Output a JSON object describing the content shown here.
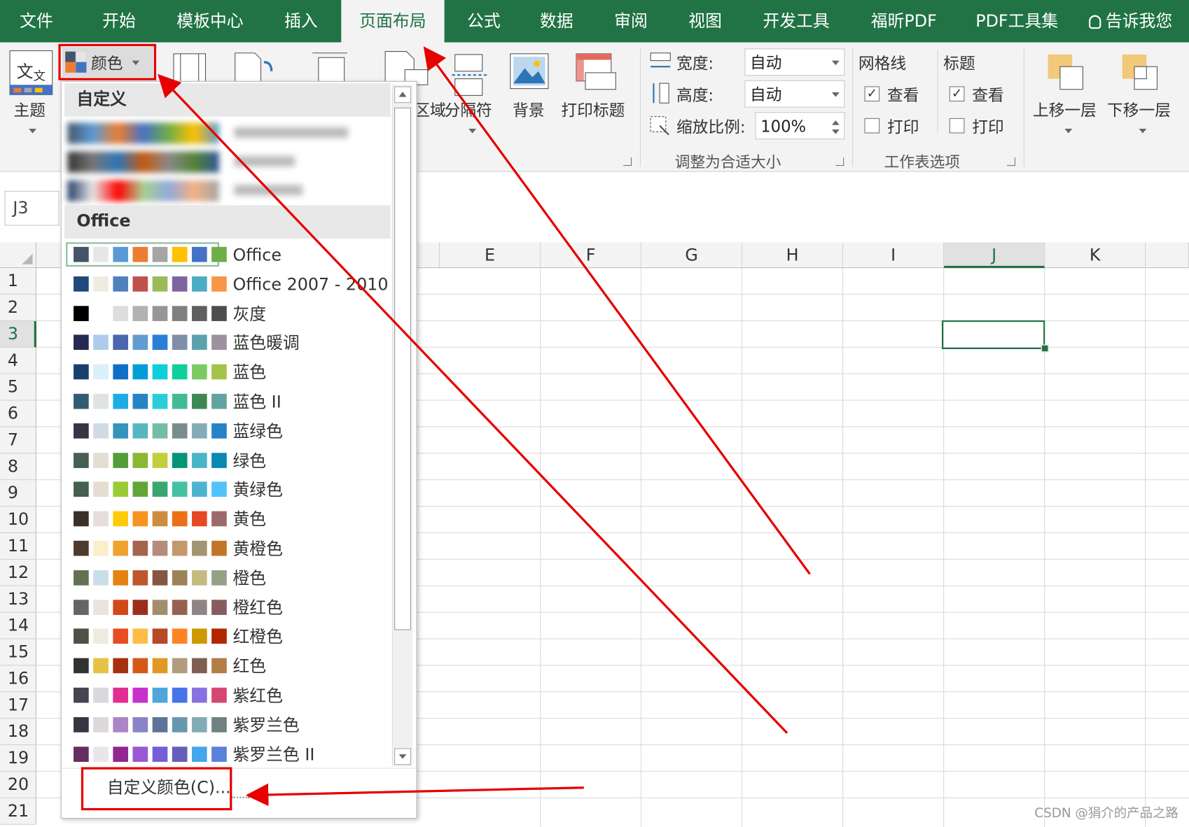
{
  "tabs": [
    "文件",
    "开始",
    "模板中心",
    "插入",
    "页面布局",
    "公式",
    "数据",
    "审阅",
    "视图",
    "开发工具",
    "福昕PDF",
    "PDF工具集",
    "告诉我您"
  ],
  "ribbon": {
    "theme_label": "主题",
    "colors_label": "颜色",
    "area_label": "区域",
    "breaks_label": "分隔符",
    "background_label": "背景",
    "print_titles_label": "打印标题",
    "width_label": "宽度:",
    "width_value": "自动",
    "height_label": "高度:",
    "height_value": "自动",
    "scale_label": "缩放比例:",
    "scale_value": "100%",
    "group_scale": "调整为合适大小",
    "gridlines_label": "网格线",
    "headings_label": "标题",
    "view_label": "查看",
    "print_label": "打印",
    "group_sheet": "工作表选项",
    "bring_forward": "上移一层",
    "send_backward": "下移一层"
  },
  "namebox": "J3",
  "columns": [
    "E",
    "F",
    "G",
    "H",
    "I",
    "J",
    "K"
  ],
  "selected_column": "J",
  "rows": [
    "1",
    "2",
    "3",
    "4",
    "5",
    "6",
    "7",
    "8",
    "9",
    "10",
    "11",
    "12",
    "13",
    "14",
    "15",
    "16",
    "17",
    "18",
    "19",
    "20",
    "21"
  ],
  "selected_row": "3",
  "dropdown": {
    "section_custom": "自定义",
    "section_office": "Office",
    "custom_colors_link": "自定义颜色(C)...",
    "themes": [
      {
        "name": "Office",
        "colors": [
          "#44546a",
          "#e7e6e6",
          "#5b9bd5",
          "#ed7d31",
          "#a5a5a5",
          "#ffc000",
          "#4472c4",
          "#70ad47"
        ]
      },
      {
        "name": "Office 2007 - 2010",
        "colors": [
          "#1f497d",
          "#eeece1",
          "#4f81bd",
          "#c0504d",
          "#9bbb59",
          "#8064a2",
          "#4bacc6",
          "#f79646"
        ]
      },
      {
        "name": "灰度",
        "colors": [
          "#000000",
          "#ffffff",
          "#dddddd",
          "#b2b2b2",
          "#969696",
          "#808080",
          "#5f5f5f",
          "#4d4d4d"
        ]
      },
      {
        "name": "蓝色暖调",
        "colors": [
          "#242852",
          "#acccea",
          "#4a66ac",
          "#629dd1",
          "#297fd5",
          "#7f8fa9",
          "#5aa2ae",
          "#9d90a0"
        ]
      },
      {
        "name": "蓝色",
        "colors": [
          "#17406d",
          "#dbeff9",
          "#0f6fc6",
          "#009dd9",
          "#0bd0d9",
          "#10cf9b",
          "#7cca62",
          "#a5c249"
        ]
      },
      {
        "name": "蓝色 II",
        "colors": [
          "#335b74",
          "#dfe3e5",
          "#1cade4",
          "#2683c6",
          "#27ced7",
          "#42ba97",
          "#3e8853",
          "#62a39f"
        ]
      },
      {
        "name": "蓝绿色",
        "colors": [
          "#373545",
          "#cedbe6",
          "#3494ba",
          "#58b6c0",
          "#75bda7",
          "#7a8c8e",
          "#84acb6",
          "#2683c6"
        ]
      },
      {
        "name": "绿色",
        "colors": [
          "#455f51",
          "#e3ded1",
          "#549e39",
          "#8ab833",
          "#c0cf3a",
          "#029676",
          "#4ab5c4",
          "#0989b1"
        ]
      },
      {
        "name": "黄绿色",
        "colors": [
          "#455f51",
          "#e3ded1",
          "#99cb38",
          "#63a537",
          "#37a76f",
          "#44c1a3",
          "#4eb3cf",
          "#51c3f9"
        ]
      },
      {
        "name": "黄色",
        "colors": [
          "#39302a",
          "#e5dedb",
          "#ffca08",
          "#f8931d",
          "#ce8d3e",
          "#ec7016",
          "#e64823",
          "#9c6a6a"
        ]
      },
      {
        "name": "黄橙色",
        "colors": [
          "#4e3b30",
          "#fbeec9",
          "#f0a22e",
          "#a5644e",
          "#b58b80",
          "#c3986d",
          "#a19574",
          "#c17529"
        ]
      },
      {
        "name": "橙色",
        "colors": [
          "#637052",
          "#ccddea",
          "#e48312",
          "#bd582c",
          "#865640",
          "#9b8357",
          "#c2bc80",
          "#94a088"
        ]
      },
      {
        "name": "橙红色",
        "colors": [
          "#696464",
          "#e9e5dc",
          "#d34817",
          "#9b2d1f",
          "#a28e6a",
          "#956251",
          "#918485",
          "#855d5d"
        ]
      },
      {
        "name": "红橙色",
        "colors": [
          "#505046",
          "#eeece1",
          "#e84c22",
          "#ffbd47",
          "#b64926",
          "#ff8427",
          "#cc9900",
          "#b22600"
        ]
      },
      {
        "name": "红色",
        "colors": [
          "#323232",
          "#e5c243",
          "#a5300f",
          "#d55816",
          "#e19825",
          "#b19c7d",
          "#7f5f52",
          "#b27d49"
        ]
      },
      {
        "name": "紫红色",
        "colors": [
          "#454551",
          "#d8d9dc",
          "#e32d91",
          "#c830cc",
          "#4ea6dc",
          "#4775e7",
          "#8971e1",
          "#d54773"
        ]
      },
      {
        "name": "紫罗兰色",
        "colors": [
          "#373545",
          "#dcd8dc",
          "#ad84c6",
          "#8784c7",
          "#5d739a",
          "#6997af",
          "#84acb6",
          "#6f8183"
        ]
      },
      {
        "name": "紫罗兰色 II",
        "colors": [
          "#632e62",
          "#eae5eb",
          "#92278f",
          "#9b57d3",
          "#755dd9",
          "#665eb8",
          "#45a5ed",
          "#5982db"
        ]
      }
    ]
  },
  "annotation_color": "#e60000",
  "excel_green": "#217346",
  "watermark": "CSDN @狷介的产品之路"
}
